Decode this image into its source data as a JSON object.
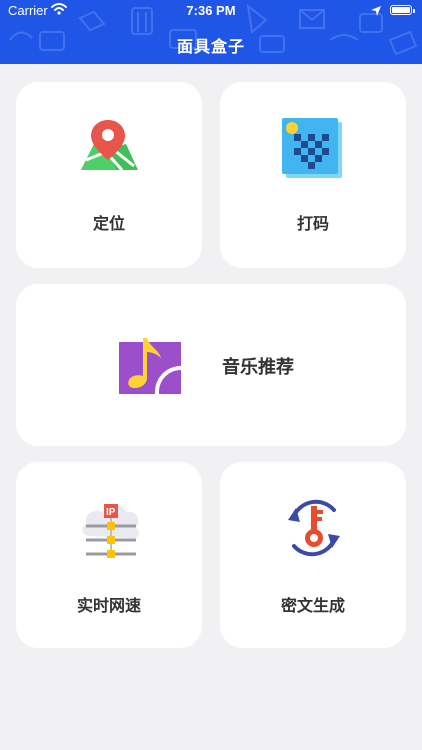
{
  "status_bar": {
    "carrier": "Carrier",
    "time": "7:36 PM"
  },
  "nav": {
    "title": "面具盒子"
  },
  "tools": {
    "location": {
      "label": "定位",
      "icon": "map-pin-icon"
    },
    "mosaic": {
      "label": "打码",
      "icon": "mosaic-image-icon"
    },
    "music": {
      "label": "音乐推荐",
      "icon": "music-note-icon"
    },
    "speed": {
      "label": "实时网速",
      "icon": "ip-cloud-network-icon"
    },
    "cipher": {
      "label": "密文生成",
      "icon": "key-refresh-icon"
    }
  },
  "colors": {
    "header": "#1f56e8",
    "background": "#f1f1f3",
    "card": "#ffffff"
  }
}
